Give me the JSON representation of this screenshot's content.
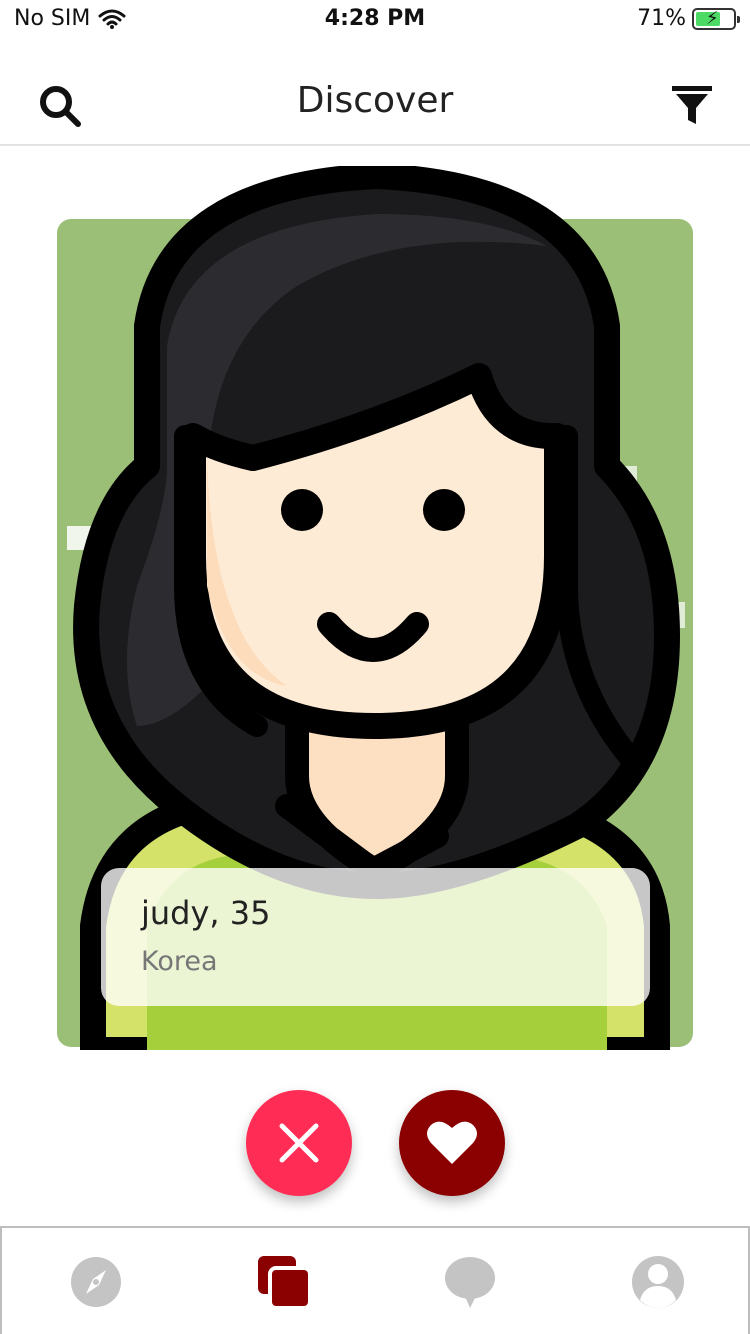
{
  "status_bar": {
    "carrier": "No SIM",
    "time": "4:28 PM",
    "battery": "71%",
    "battery_level": 0.71
  },
  "header": {
    "title": "Discover"
  },
  "card": {
    "name_age": "judy, 35",
    "location": "Korea"
  },
  "colors": {
    "accent": "#8b0000",
    "nope": "#ff2d55",
    "card_bg": "#9cbf77",
    "tab_inactive": "#c4c4c4"
  },
  "tabs": [
    {
      "icon": "compass-icon",
      "active": false
    },
    {
      "icon": "cards-icon",
      "active": true
    },
    {
      "icon": "chat-bubble-icon",
      "active": false
    },
    {
      "icon": "profile-icon",
      "active": false
    }
  ]
}
